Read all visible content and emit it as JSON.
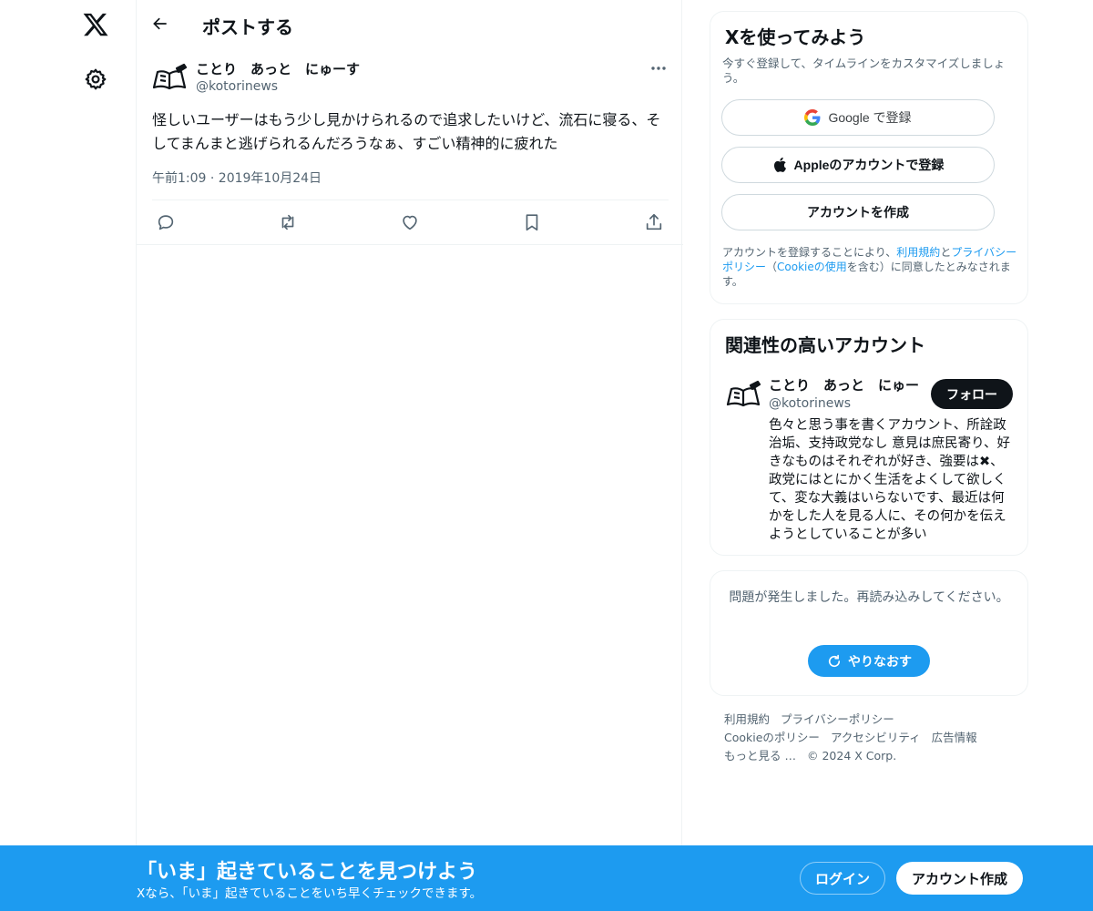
{
  "nav": {
    "logo_icon": "x-logo-icon",
    "settings_icon": "gear-icon"
  },
  "header": {
    "title": "ポストする"
  },
  "post": {
    "author_name": "ことり　あっと　にゅーす",
    "author_handle": "@kotorinews",
    "text": "怪しいユーザーはもう少し見かけられるので追求したいけど、流石に寝る、そしてまんまと逃げられるんだろうなぁ、すごい精神的に疲れた",
    "timestamp": "午前1:09 · 2019年10月24日",
    "actions": [
      "reply-icon",
      "repost-icon",
      "like-icon",
      "bookmark-icon",
      "share-icon"
    ]
  },
  "signup": {
    "title": "Xを使ってみよう",
    "subtitle": "今すぐ登録して、タイムラインをカスタマイズしましょう。",
    "google_label": "Google で登録",
    "apple_label": "Appleのアカウントで登録",
    "create_label": "アカウントを作成",
    "legal_prefix": "アカウントを登録することにより、",
    "legal_terms": "利用規約",
    "legal_and": "と",
    "legal_privacy": "プライバシーポリシー",
    "legal_open": "（",
    "legal_cookie": "Cookieの使用",
    "legal_suffix": "を含む）に同意したとみなされます。"
  },
  "related": {
    "title": "関連性の高いアカウント",
    "name": "ことり　あっと　にゅー",
    "handle": "@kotorinews",
    "follow_label": "フォロー",
    "bio": "色々と思う事を書くアカウント、所詮政治垢、支持政党なし 意見は庶民寄り、好きなものはそれぞれが好き、強要は✖、政党にはとにかく生活をよくして欲しくて、変な大義はいらないです、最近は何かをした人を見る人に、その何かを伝えようとしていることが多い"
  },
  "error": {
    "message": "問題が発生しました。再読み込みしてください。",
    "retry_label": "やりなおす"
  },
  "footer": {
    "links": [
      "利用規約",
      "プライバシーポリシー",
      "Cookieのポリシー",
      "アクセシビリティ",
      "広告情報",
      "もっと見る …",
      "© 2024 X Corp."
    ]
  },
  "banner": {
    "title": "「いま」起きていることを見つけよう",
    "subtitle": "Xなら、「いま」起きていることをいち早くチェックできます。",
    "login_label": "ログイン",
    "signup_label": "アカウント作成"
  },
  "colors": {
    "accent": "#1d9bf0",
    "text": "#0f1419",
    "muted": "#536471",
    "border": "#eff3f4"
  }
}
